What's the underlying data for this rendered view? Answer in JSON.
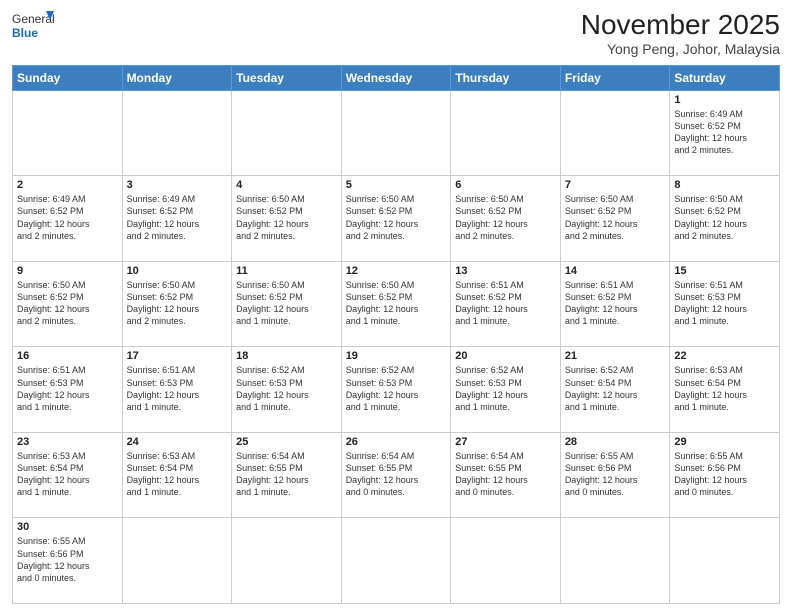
{
  "header": {
    "logo_general": "General",
    "logo_blue": "Blue",
    "month_title": "November 2025",
    "location": "Yong Peng, Johor, Malaysia"
  },
  "weekdays": [
    "Sunday",
    "Monday",
    "Tuesday",
    "Wednesday",
    "Thursday",
    "Friday",
    "Saturday"
  ],
  "weeks": [
    [
      {
        "day": "",
        "info": ""
      },
      {
        "day": "",
        "info": ""
      },
      {
        "day": "",
        "info": ""
      },
      {
        "day": "",
        "info": ""
      },
      {
        "day": "",
        "info": ""
      },
      {
        "day": "",
        "info": ""
      },
      {
        "day": "1",
        "info": "Sunrise: 6:49 AM\nSunset: 6:52 PM\nDaylight: 12 hours\nand 2 minutes."
      }
    ],
    [
      {
        "day": "2",
        "info": "Sunrise: 6:49 AM\nSunset: 6:52 PM\nDaylight: 12 hours\nand 2 minutes."
      },
      {
        "day": "3",
        "info": "Sunrise: 6:49 AM\nSunset: 6:52 PM\nDaylight: 12 hours\nand 2 minutes."
      },
      {
        "day": "4",
        "info": "Sunrise: 6:50 AM\nSunset: 6:52 PM\nDaylight: 12 hours\nand 2 minutes."
      },
      {
        "day": "5",
        "info": "Sunrise: 6:50 AM\nSunset: 6:52 PM\nDaylight: 12 hours\nand 2 minutes."
      },
      {
        "day": "6",
        "info": "Sunrise: 6:50 AM\nSunset: 6:52 PM\nDaylight: 12 hours\nand 2 minutes."
      },
      {
        "day": "7",
        "info": "Sunrise: 6:50 AM\nSunset: 6:52 PM\nDaylight: 12 hours\nand 2 minutes."
      },
      {
        "day": "8",
        "info": "Sunrise: 6:50 AM\nSunset: 6:52 PM\nDaylight: 12 hours\nand 2 minutes."
      }
    ],
    [
      {
        "day": "9",
        "info": "Sunrise: 6:50 AM\nSunset: 6:52 PM\nDaylight: 12 hours\nand 2 minutes."
      },
      {
        "day": "10",
        "info": "Sunrise: 6:50 AM\nSunset: 6:52 PM\nDaylight: 12 hours\nand 2 minutes."
      },
      {
        "day": "11",
        "info": "Sunrise: 6:50 AM\nSunset: 6:52 PM\nDaylight: 12 hours\nand 1 minute."
      },
      {
        "day": "12",
        "info": "Sunrise: 6:50 AM\nSunset: 6:52 PM\nDaylight: 12 hours\nand 1 minute."
      },
      {
        "day": "13",
        "info": "Sunrise: 6:51 AM\nSunset: 6:52 PM\nDaylight: 12 hours\nand 1 minute."
      },
      {
        "day": "14",
        "info": "Sunrise: 6:51 AM\nSunset: 6:52 PM\nDaylight: 12 hours\nand 1 minute."
      },
      {
        "day": "15",
        "info": "Sunrise: 6:51 AM\nSunset: 6:53 PM\nDaylight: 12 hours\nand 1 minute."
      }
    ],
    [
      {
        "day": "16",
        "info": "Sunrise: 6:51 AM\nSunset: 6:53 PM\nDaylight: 12 hours\nand 1 minute."
      },
      {
        "day": "17",
        "info": "Sunrise: 6:51 AM\nSunset: 6:53 PM\nDaylight: 12 hours\nand 1 minute."
      },
      {
        "day": "18",
        "info": "Sunrise: 6:52 AM\nSunset: 6:53 PM\nDaylight: 12 hours\nand 1 minute."
      },
      {
        "day": "19",
        "info": "Sunrise: 6:52 AM\nSunset: 6:53 PM\nDaylight: 12 hours\nand 1 minute."
      },
      {
        "day": "20",
        "info": "Sunrise: 6:52 AM\nSunset: 6:53 PM\nDaylight: 12 hours\nand 1 minute."
      },
      {
        "day": "21",
        "info": "Sunrise: 6:52 AM\nSunset: 6:54 PM\nDaylight: 12 hours\nand 1 minute."
      },
      {
        "day": "22",
        "info": "Sunrise: 6:53 AM\nSunset: 6:54 PM\nDaylight: 12 hours\nand 1 minute."
      }
    ],
    [
      {
        "day": "23",
        "info": "Sunrise: 6:53 AM\nSunset: 6:54 PM\nDaylight: 12 hours\nand 1 minute."
      },
      {
        "day": "24",
        "info": "Sunrise: 6:53 AM\nSunset: 6:54 PM\nDaylight: 12 hours\nand 1 minute."
      },
      {
        "day": "25",
        "info": "Sunrise: 6:54 AM\nSunset: 6:55 PM\nDaylight: 12 hours\nand 1 minute."
      },
      {
        "day": "26",
        "info": "Sunrise: 6:54 AM\nSunset: 6:55 PM\nDaylight: 12 hours\nand 0 minutes."
      },
      {
        "day": "27",
        "info": "Sunrise: 6:54 AM\nSunset: 6:55 PM\nDaylight: 12 hours\nand 0 minutes."
      },
      {
        "day": "28",
        "info": "Sunrise: 6:55 AM\nSunset: 6:56 PM\nDaylight: 12 hours\nand 0 minutes."
      },
      {
        "day": "29",
        "info": "Sunrise: 6:55 AM\nSunset: 6:56 PM\nDaylight: 12 hours\nand 0 minutes."
      }
    ],
    [
      {
        "day": "30",
        "info": "Sunrise: 6:55 AM\nSunset: 6:56 PM\nDaylight: 12 hours\nand 0 minutes."
      },
      {
        "day": "",
        "info": ""
      },
      {
        "day": "",
        "info": ""
      },
      {
        "day": "",
        "info": ""
      },
      {
        "day": "",
        "info": ""
      },
      {
        "day": "",
        "info": ""
      },
      {
        "day": "",
        "info": ""
      }
    ]
  ]
}
